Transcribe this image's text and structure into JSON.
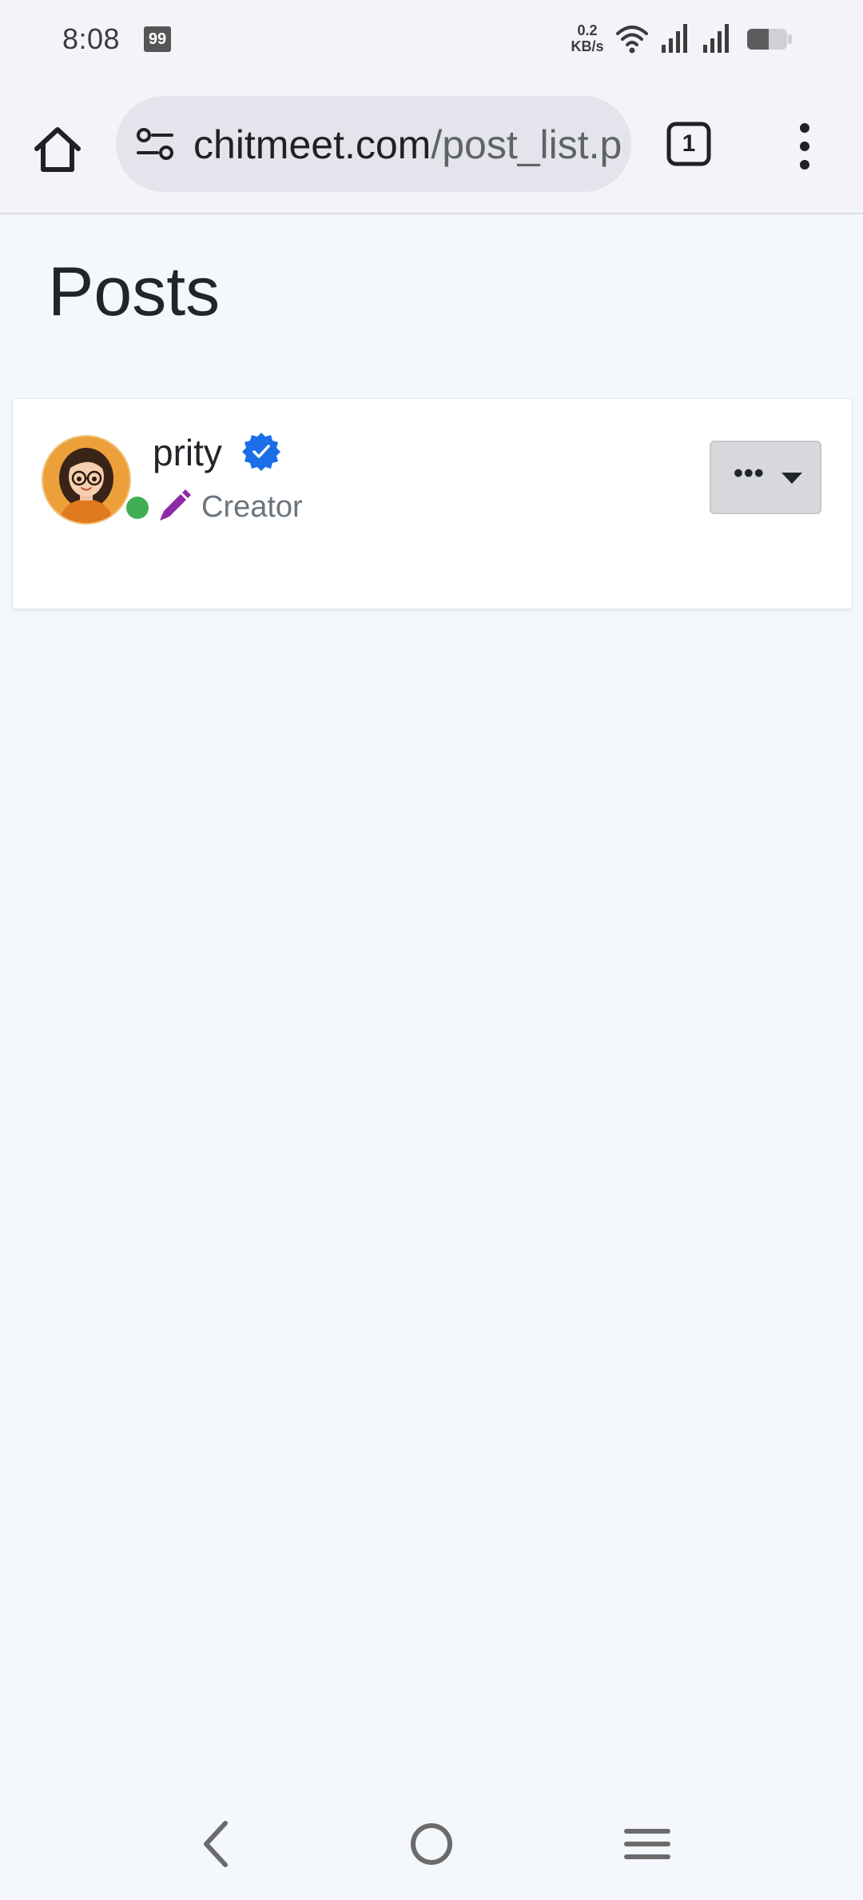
{
  "status_bar": {
    "time": "8:08",
    "notification_badge": "99",
    "net_speed_value": "0.2",
    "net_speed_unit": "KB/s",
    "icons": [
      "wifi-icon",
      "signal-icon",
      "signal-icon",
      "battery-icon"
    ]
  },
  "browser": {
    "url_domain": "chitmeet.com",
    "url_path": "/post_list.p",
    "tab_count": "1",
    "icons": [
      "home-icon",
      "tune-icon",
      "tabs-icon",
      "more-vert-icon"
    ]
  },
  "page": {
    "title": "Posts"
  },
  "post": {
    "username": "prity",
    "role": "Creator",
    "options_dots": "•••",
    "status_color": "#3fae52",
    "verified_color": "#1a6ee8",
    "role_icon_color": "#8e2aa8"
  },
  "nav_bar": {
    "buttons": [
      "back-icon",
      "home-circle-icon",
      "recents-menu-icon"
    ]
  }
}
